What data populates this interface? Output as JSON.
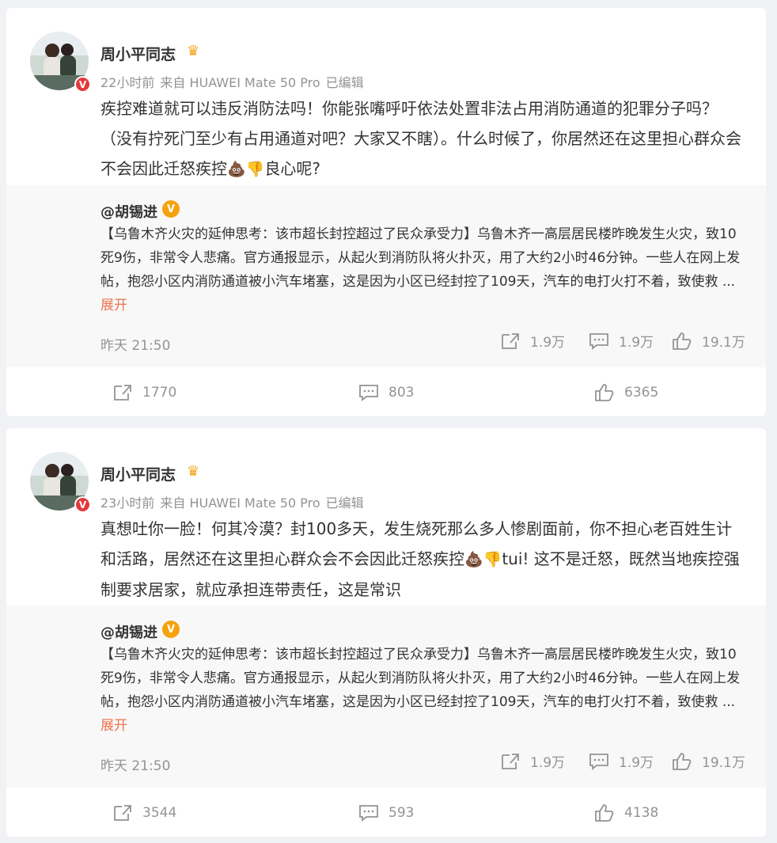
{
  "posts": [
    {
      "author": "周小平同志",
      "meta": {
        "time": "22小时前",
        "source": "来自 HUAWEI Mate 50 Pro",
        "edited": "已编辑"
      },
      "text": "疾控难道就可以违反消防法吗！你能张嘴呼吁依法处置非法占用消防通道的犯罪分子吗？（没有拧死门至少有占用通道对吧？大家又不瞎）。什么时候了，你居然还在这里担心群众会不会因此迁怒疾控",
      "text_tail": "良心呢?",
      "repost": {
        "author": "@胡锡进",
        "text": "【乌鲁木齐火灾的延伸思考：该市超长封控超过了民众承受力】乌鲁木齐一高层居民楼昨晚发生火灾，致10死9伤，非常令人悲痛。官方通报显示，从起火到消防队将火扑灭，用了大约2小时46分钟。一些人在网上发帖，抱怨小区内消防通道被小汽车堵塞，这是因为小区已经封控了109天，汽车的电打火打不着，致使救 ...",
        "expand": "展开",
        "time": "昨天 21:50",
        "shares": "1.9万",
        "comments": "1.9万",
        "likes": "19.1万"
      },
      "footer": {
        "shares": "1770",
        "comments": "803",
        "likes": "6365"
      }
    },
    {
      "author": "周小平同志",
      "meta": {
        "time": "23小时前",
        "source": "来自 HUAWEI Mate 50 Pro",
        "edited": "已编辑"
      },
      "text": "真想吐你一脸！何其冷漠？封100多天，发生烧死那么多人惨剧面前，你不担心老百姓生计和活路，居然还在这里担心群众会不会因此迁怒疾控",
      "text_tail": "tui! 这不是迁怒，既然当地疾控强制要求居家，就应承担连带责任，这是常识",
      "repost": {
        "author": "@胡锡进",
        "text": "【乌鲁木齐火灾的延伸思考：该市超长封控超过了民众承受力】乌鲁木齐一高层居民楼昨晚发生火灾，致10死9伤，非常令人悲痛。官方通报显示，从起火到消防队将火扑灭，用了大约2小时46分钟。一些人在网上发帖，抱怨小区内消防通道被小汽车堵塞，这是因为小区已经封控了109天，汽车的电打火打不着，致使救 ...",
        "expand": "展开",
        "time": "昨天 21:50",
        "shares": "1.9万",
        "comments": "1.9万",
        "likes": "19.1万"
      },
      "footer": {
        "shares": "3544",
        "comments": "593",
        "likes": "4138"
      }
    }
  ],
  "icons": {
    "verified_badge": "V",
    "crown": "♛",
    "poop": "💩",
    "thumbs_down": "👎"
  },
  "colors": {
    "accent": "#eb7350",
    "verified": "#e4393c",
    "badge_gold": "#f5a20c"
  }
}
